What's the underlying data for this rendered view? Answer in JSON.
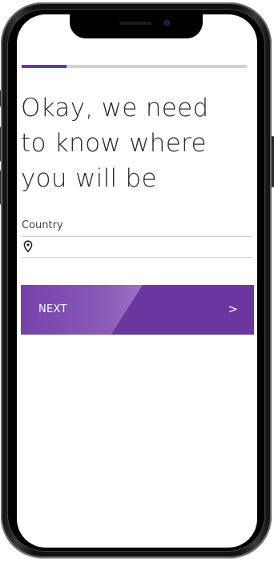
{
  "progress": {
    "fraction": 0.2
  },
  "heading": {
    "line1": "Okay, we need",
    "line2": "to know where",
    "line3": "you will be"
  },
  "country_field": {
    "label": "Country",
    "value": "",
    "icon": "location-pin-icon"
  },
  "next_button": {
    "label": "NEXT",
    "arrow": ">"
  },
  "colors": {
    "accent": "#6a37a0",
    "track": "#d3d3d3",
    "text": "#2b2b2b"
  }
}
